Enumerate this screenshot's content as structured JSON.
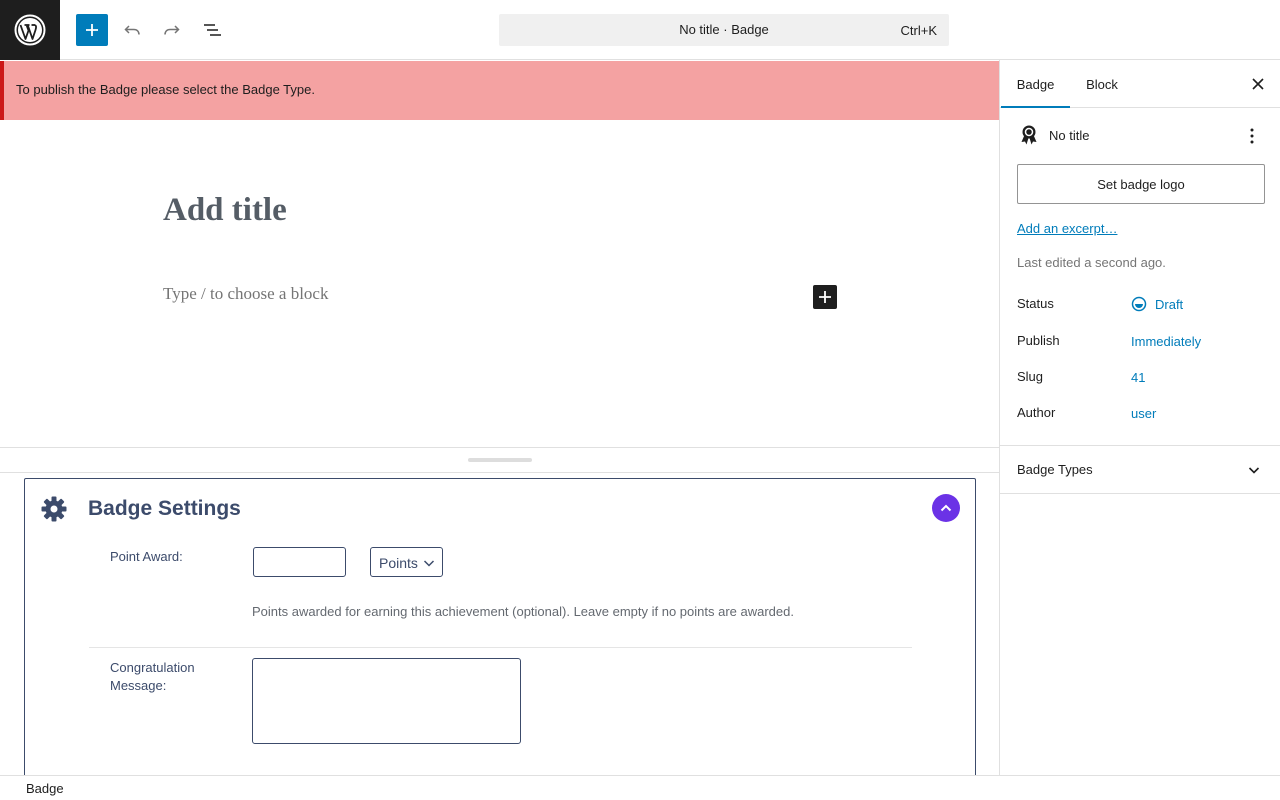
{
  "topbar": {
    "command_title": "No title · Badge",
    "command_shortcut": "Ctrl+K"
  },
  "notice": {
    "text": "To publish the Badge please select the Badge Type."
  },
  "editor": {
    "title_placeholder": "Add title",
    "block_placeholder": "Type / to choose a block"
  },
  "metabox": {
    "title": "Badge Settings",
    "point_award_label": "Point Award:",
    "point_award_value": "",
    "points_select_value": "Points",
    "points_help": "Points awarded for earning this achievement (optional). Leave empty if no points are awarded.",
    "congrats_label": "Congratulation Message:",
    "congrats_value": ""
  },
  "footer": {
    "breadcrumb": "Badge"
  },
  "sidebar": {
    "tabs": [
      {
        "label": "Badge",
        "active": true
      },
      {
        "label": "Block",
        "active": false
      }
    ],
    "post_title": "No title",
    "set_logo_label": "Set badge logo",
    "excerpt_link": "Add an excerpt…",
    "last_edited": "Last edited a second ago.",
    "rows": {
      "status": {
        "label": "Status",
        "value": "Draft"
      },
      "publish": {
        "label": "Publish",
        "value": "Immediately"
      },
      "slug": {
        "label": "Slug",
        "value": "41"
      },
      "author": {
        "label": "Author",
        "value": "user"
      }
    },
    "badge_types_label": "Badge Types"
  },
  "colors": {
    "accent": "#007cba",
    "notice_bg": "#f4a2a2",
    "notice_border": "#cc1818",
    "metabox_toggle": "#6b32e6",
    "metabox_text": "#3c4b6b"
  },
  "icons": {
    "logo": "wordpress-icon",
    "add": "plus-icon",
    "undo": "undo-icon",
    "redo": "redo-icon",
    "list_view": "list-view-icon",
    "close": "close-icon",
    "badge": "award-icon",
    "more": "more-vertical-icon",
    "settings": "gear-icon",
    "collapse": "chevron-up-icon",
    "expand": "chevron-down-icon",
    "draft": "draft-status-icon"
  }
}
